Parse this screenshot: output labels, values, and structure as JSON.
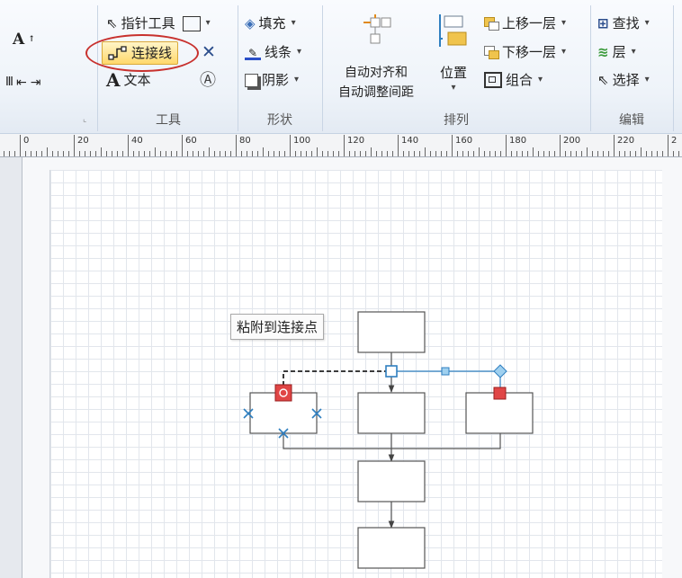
{
  "ribbon": {
    "tools": {
      "pointer_label": "指针工具",
      "connector_label": "连接线",
      "text_label": "文本",
      "group_label": "工具"
    },
    "shape": {
      "fill_label": "填充",
      "line_label": "线条",
      "shadow_label": "阴影",
      "group_label": "形状"
    },
    "arrange": {
      "auto_align_line1": "自动对齐和",
      "auto_align_line2": "自动调整间距",
      "position_label": "位置",
      "bring_forward_label": "上移一层",
      "send_backward_label": "下移一层",
      "group_label_btn": "组合",
      "group_label": "排列"
    },
    "edit": {
      "find_label": "查找",
      "layer_label": "层",
      "select_label": "选择",
      "group_label": "编辑"
    }
  },
  "ruler": {
    "labels": [
      "0",
      "20",
      "40",
      "60",
      "80",
      "100",
      "120",
      "140",
      "160",
      "180",
      "200",
      "220",
      "2"
    ]
  },
  "canvas": {
    "tooltip": "粘附到连接点"
  },
  "colors": {
    "accent_highlight": "#ffd86b",
    "annotation_oval": "#c8312e",
    "glue_point": "#e04646",
    "connector_blue": "#2f7fc0"
  }
}
